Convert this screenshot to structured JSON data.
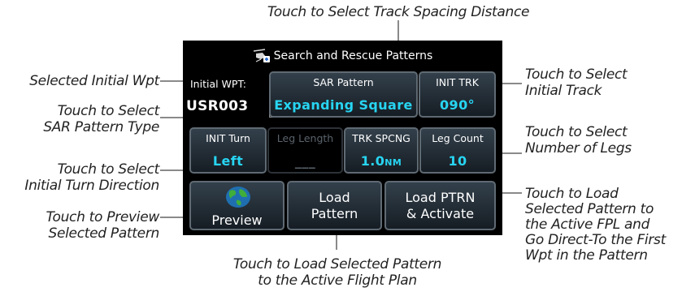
{
  "window": {
    "title": "Search and Rescue Patterns"
  },
  "initial_wpt": {
    "label": "Initial WPT:",
    "value": "USR003"
  },
  "sar_pattern": {
    "label": "SAR Pattern",
    "value": "Expanding Square"
  },
  "init_trk": {
    "label": "INIT TRK",
    "value": "090°"
  },
  "init_turn": {
    "label": "INIT Turn",
    "value": "Left"
  },
  "leg_length": {
    "label": "Leg Length",
    "value": "___"
  },
  "trk_spcng": {
    "label": "TRK SPCNG",
    "value": "1.0",
    "unit": "NM"
  },
  "leg_count": {
    "label": "Leg Count",
    "value": "10"
  },
  "preview_button": {
    "label": "Preview"
  },
  "load_pattern_button": {
    "line1": "Load",
    "line2": "Pattern"
  },
  "load_activate_button": {
    "line1": "Load PTRN",
    "line2": "& Activate"
  },
  "callouts": {
    "track_spacing": "Touch to Select Track Spacing Distance",
    "selected_initial_wpt": "Selected Initial Wpt",
    "sar_pattern_type": [
      "Touch to Select",
      "SAR Pattern Type"
    ],
    "initial_turn": [
      "Touch to Select",
      "Initial Turn Direction"
    ],
    "preview": [
      "Touch to Preview",
      "Selected Pattern"
    ],
    "load_pattern": [
      "Touch to Load Selected Pattern",
      "to the Active Flight Plan"
    ],
    "initial_track": [
      "Touch to Select",
      "Initial Track"
    ],
    "number_of_legs": [
      "Touch to Select",
      "Number of Legs"
    ],
    "load_activate": [
      "Touch to Load",
      "Selected Pattern to",
      "the Active FPL and",
      "Go Direct-To the First",
      "Wpt in the Pattern"
    ]
  },
  "colors": {
    "value_cyan": "#27d5f2",
    "button_border": "#5f6a73",
    "screen_bg": "#000000"
  }
}
